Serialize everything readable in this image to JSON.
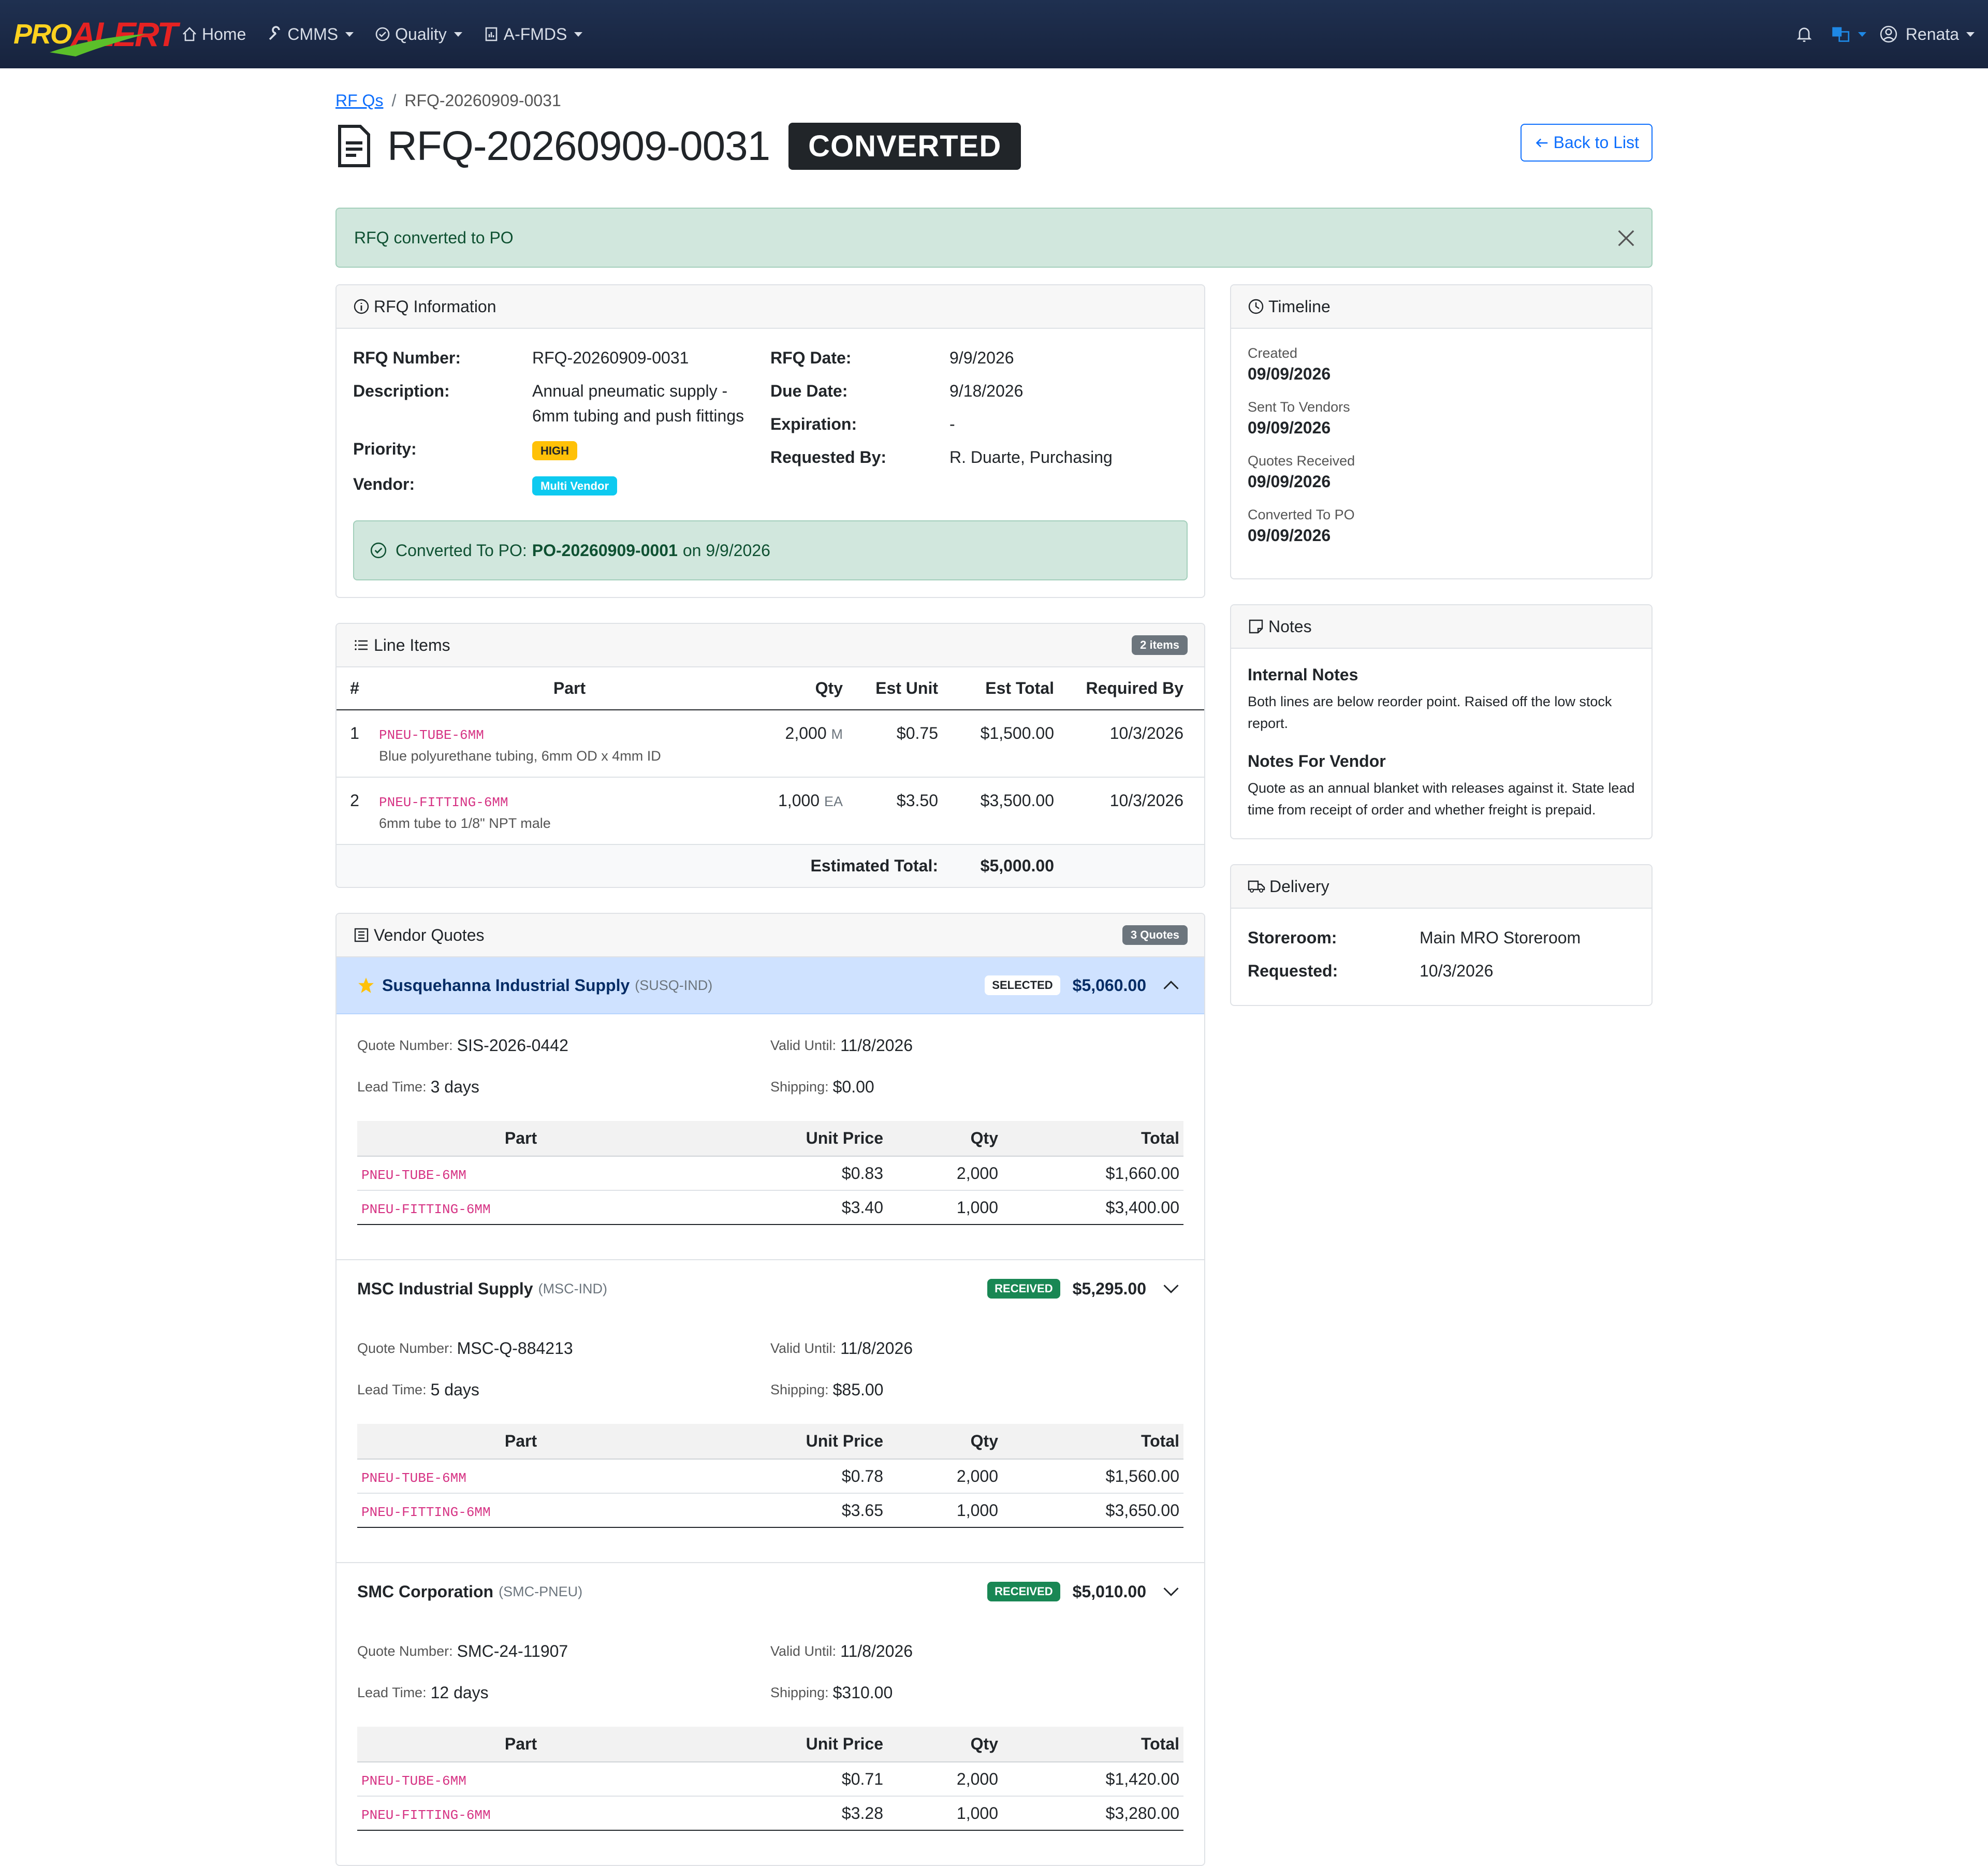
{
  "nav": {
    "logo_pro": "PRO",
    "logo_alert": "ALERT",
    "home": "Home",
    "cmms": "CMMS",
    "quality": "Quality",
    "afmds": "A-FMDS",
    "user": "Renata"
  },
  "breadcrumb": {
    "root": "RF Qs",
    "sep": "/",
    "current": "RFQ-20260909-0031"
  },
  "header": {
    "title": "RFQ-20260909-0031",
    "status": "CONVERTED",
    "back_label": "Back to List"
  },
  "alert": {
    "message": "RFQ converted to PO"
  },
  "rfq_info": {
    "title": "RFQ Information",
    "rfq_number_label": "RFQ Number:",
    "rfq_number": "RFQ-20260909-0031",
    "description_label": "Description:",
    "description": "Annual pneumatic supply - 6mm tubing and push fittings",
    "priority_label": "Priority:",
    "priority": "HIGH",
    "vendor_label": "Vendor:",
    "vendor": "Multi Vendor",
    "rfq_date_label": "RFQ Date:",
    "rfq_date": "9/9/2026",
    "due_date_label": "Due Date:",
    "due_date": "9/18/2026",
    "expiration_label": "Expiration:",
    "expiration": "-",
    "requested_by_label": "Requested By:",
    "requested_by": "R. Duarte, Purchasing",
    "converted_prefix": "Converted To PO:",
    "converted_po": "PO-20260909-0001",
    "converted_suffix": "on 9/9/2026"
  },
  "line_items": {
    "title": "Line Items",
    "count": "2 items",
    "headers": {
      "num": "#",
      "part": "Part",
      "qty": "Qty",
      "est_unit": "Est Unit",
      "est_total": "Est Total",
      "required_by": "Required By"
    },
    "rows": [
      {
        "num": "1",
        "code": "PNEU-TUBE-6MM",
        "desc": "Blue polyurethane tubing, 6mm OD x 4mm ID",
        "qty": "2,000",
        "uom": "M",
        "unit": "$0.75",
        "total": "$1,500.00",
        "required": "10/3/2026"
      },
      {
        "num": "2",
        "code": "PNEU-FITTING-6MM",
        "desc": "6mm tube to 1/8\" NPT male",
        "qty": "1,000",
        "uom": "EA",
        "unit": "$3.50",
        "total": "$3,500.00",
        "required": "10/3/2026"
      }
    ],
    "estimated_total_label": "Estimated Total:",
    "estimated_total": "$5,000.00"
  },
  "vendor_quotes": {
    "title": "Vendor Quotes",
    "count": "3 Quotes",
    "labels": {
      "quote_number": "Quote Number:",
      "valid_until": "Valid Until:",
      "lead_time": "Lead Time:",
      "shipping": "Shipping:",
      "part": "Part",
      "unit_price": "Unit Price",
      "qty": "Qty",
      "total": "Total"
    },
    "quotes": [
      {
        "name": "Susquehanna Industrial Supply",
        "code": "(SUSQ-IND)",
        "status": "SELECTED",
        "amount": "$5,060.00",
        "quote_number": "SIS-2026-0442",
        "valid_until": "11/8/2026",
        "lead_time": "3 days",
        "shipping": "$0.00",
        "rows": [
          {
            "part": "PNEU-TUBE-6MM",
            "unit_price": "$0.83",
            "qty": "2,000",
            "total": "$1,660.00"
          },
          {
            "part": "PNEU-FITTING-6MM",
            "unit_price": "$3.40",
            "qty": "1,000",
            "total": "$3,400.00"
          }
        ]
      },
      {
        "name": "MSC Industrial Supply",
        "code": "(MSC-IND)",
        "status": "RECEIVED",
        "amount": "$5,295.00",
        "quote_number": "MSC-Q-884213",
        "valid_until": "11/8/2026",
        "lead_time": "5 days",
        "shipping": "$85.00",
        "rows": [
          {
            "part": "PNEU-TUBE-6MM",
            "unit_price": "$0.78",
            "qty": "2,000",
            "total": "$1,560.00"
          },
          {
            "part": "PNEU-FITTING-6MM",
            "unit_price": "$3.65",
            "qty": "1,000",
            "total": "$3,650.00"
          }
        ]
      },
      {
        "name": "SMC Corporation",
        "code": "(SMC-PNEU)",
        "status": "RECEIVED",
        "amount": "$5,010.00",
        "quote_number": "SMC-24-11907",
        "valid_until": "11/8/2026",
        "lead_time": "12 days",
        "shipping": "$310.00",
        "rows": [
          {
            "part": "PNEU-TUBE-6MM",
            "unit_price": "$0.71",
            "qty": "2,000",
            "total": "$1,420.00"
          },
          {
            "part": "PNEU-FITTING-6MM",
            "unit_price": "$3.28",
            "qty": "1,000",
            "total": "$3,280.00"
          }
        ]
      }
    ]
  },
  "timeline": {
    "title": "Timeline",
    "events": [
      {
        "label": "Created",
        "date": "09/09/2026"
      },
      {
        "label": "Sent To Vendors",
        "date": "09/09/2026"
      },
      {
        "label": "Quotes Received",
        "date": "09/09/2026"
      },
      {
        "label": "Converted To PO",
        "date": "09/09/2026"
      }
    ]
  },
  "notes": {
    "title": "Notes",
    "internal_label": "Internal Notes",
    "internal": "Both lines are below reorder point. Raised off the low stock report.",
    "vendor_label": "Notes For Vendor",
    "vendor": "Quote as an annual blanket with releases against it. State lead time from receipt of order and whether freight is prepaid."
  },
  "delivery": {
    "title": "Delivery",
    "storeroom_label": "Storeroom:",
    "storeroom": "Main MRO Storeroom",
    "requested_label": "Requested:",
    "requested": "10/3/2026"
  },
  "colors": {
    "primary": "#0d6efd",
    "success_bg": "#d1e7dd",
    "navbar": "#1f3050",
    "code_pink": "#d63384"
  }
}
